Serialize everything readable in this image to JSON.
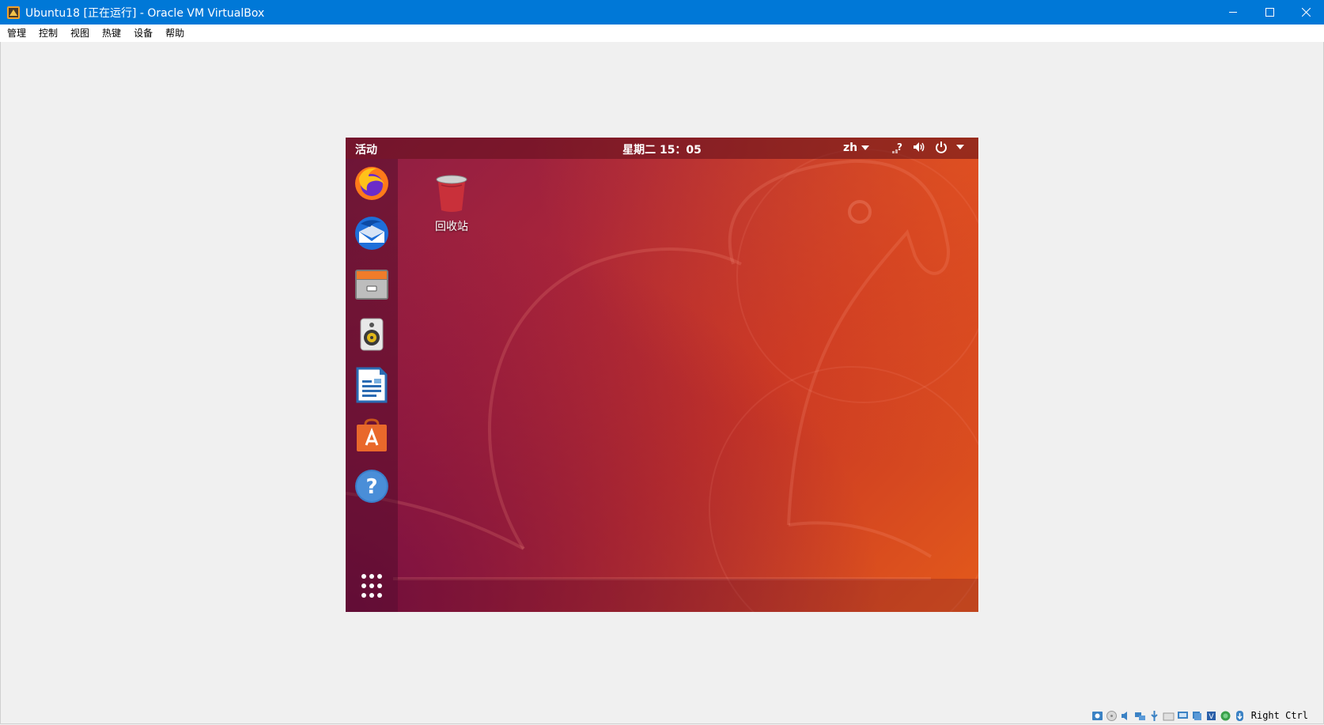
{
  "window": {
    "title": "Ubuntu18 [正在运行] - Oracle VM VirtualBox",
    "icons": {
      "app": "virtualbox-icon",
      "minimize": "minimize-icon",
      "maximize": "maximize-icon",
      "close": "close-icon"
    },
    "accent_color": "#0078d7"
  },
  "menubar": {
    "items": [
      {
        "label": "管理"
      },
      {
        "label": "控制"
      },
      {
        "label": "视图"
      },
      {
        "label": "热键"
      },
      {
        "label": "设备"
      },
      {
        "label": "帮助"
      }
    ]
  },
  "guest": {
    "topbar": {
      "activities": "活动",
      "clock": "星期二 15：05",
      "language": "zh",
      "tray_icons": [
        "network-question-icon",
        "volume-icon",
        "power-icon",
        "chevron-down-icon"
      ]
    },
    "dock": {
      "items": [
        {
          "name": "firefox-icon"
        },
        {
          "name": "thunderbird-icon"
        },
        {
          "name": "files-icon"
        },
        {
          "name": "rhythmbox-icon"
        },
        {
          "name": "libreoffice-writer-icon"
        },
        {
          "name": "ubuntu-software-icon"
        },
        {
          "name": "help-icon"
        }
      ],
      "show_apps": "app-grid-icon"
    },
    "desktop": {
      "trash_label": "回收站"
    },
    "colors": {
      "wallpaper_start": "#7a0f49",
      "wallpaper_end": "#e35a1b"
    }
  },
  "statusbar": {
    "icons": [
      "hard-disk-icon",
      "optical-drive-icon",
      "audio-icon",
      "network-icon",
      "usb-icon",
      "shared-folders-icon",
      "display-icon",
      "recording-icon",
      "cpu-icon",
      "guest-additions-icon",
      "mouse-integration-icon",
      "keyboard-capture-icon"
    ],
    "host_key": "Right Ctrl"
  }
}
